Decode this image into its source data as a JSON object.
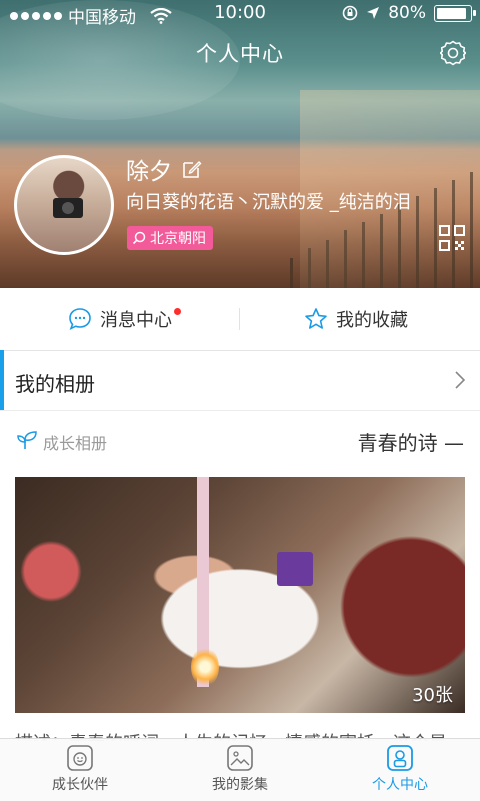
{
  "status_bar": {
    "carrier": "中国移动",
    "time": "10:00",
    "battery": "80%"
  },
  "header": {
    "title": "个人中心"
  },
  "profile": {
    "name": "除夕",
    "motto": "向日葵的花语丶沉默的爱 _纯洁的泪",
    "location": "北京朝阳"
  },
  "quick_actions": {
    "messages_label": "消息中心",
    "favorites_label": "我的收藏"
  },
  "album": {
    "title": "我的相册",
    "category": "成长相册",
    "name": "青春的诗 —",
    "photo_count": "30张",
    "description": "描述：青春的呼词，人生的记忆，情感的寄托。这个是……"
  },
  "tabs": [
    {
      "label": "成长伙伴",
      "active": false
    },
    {
      "label": "我的影集",
      "active": false
    },
    {
      "label": "个人中心",
      "active": true
    }
  ],
  "colors": {
    "accent": "#1a9be6",
    "location_badge": "#f25a99",
    "notification_dot": "#ff2d2d"
  }
}
